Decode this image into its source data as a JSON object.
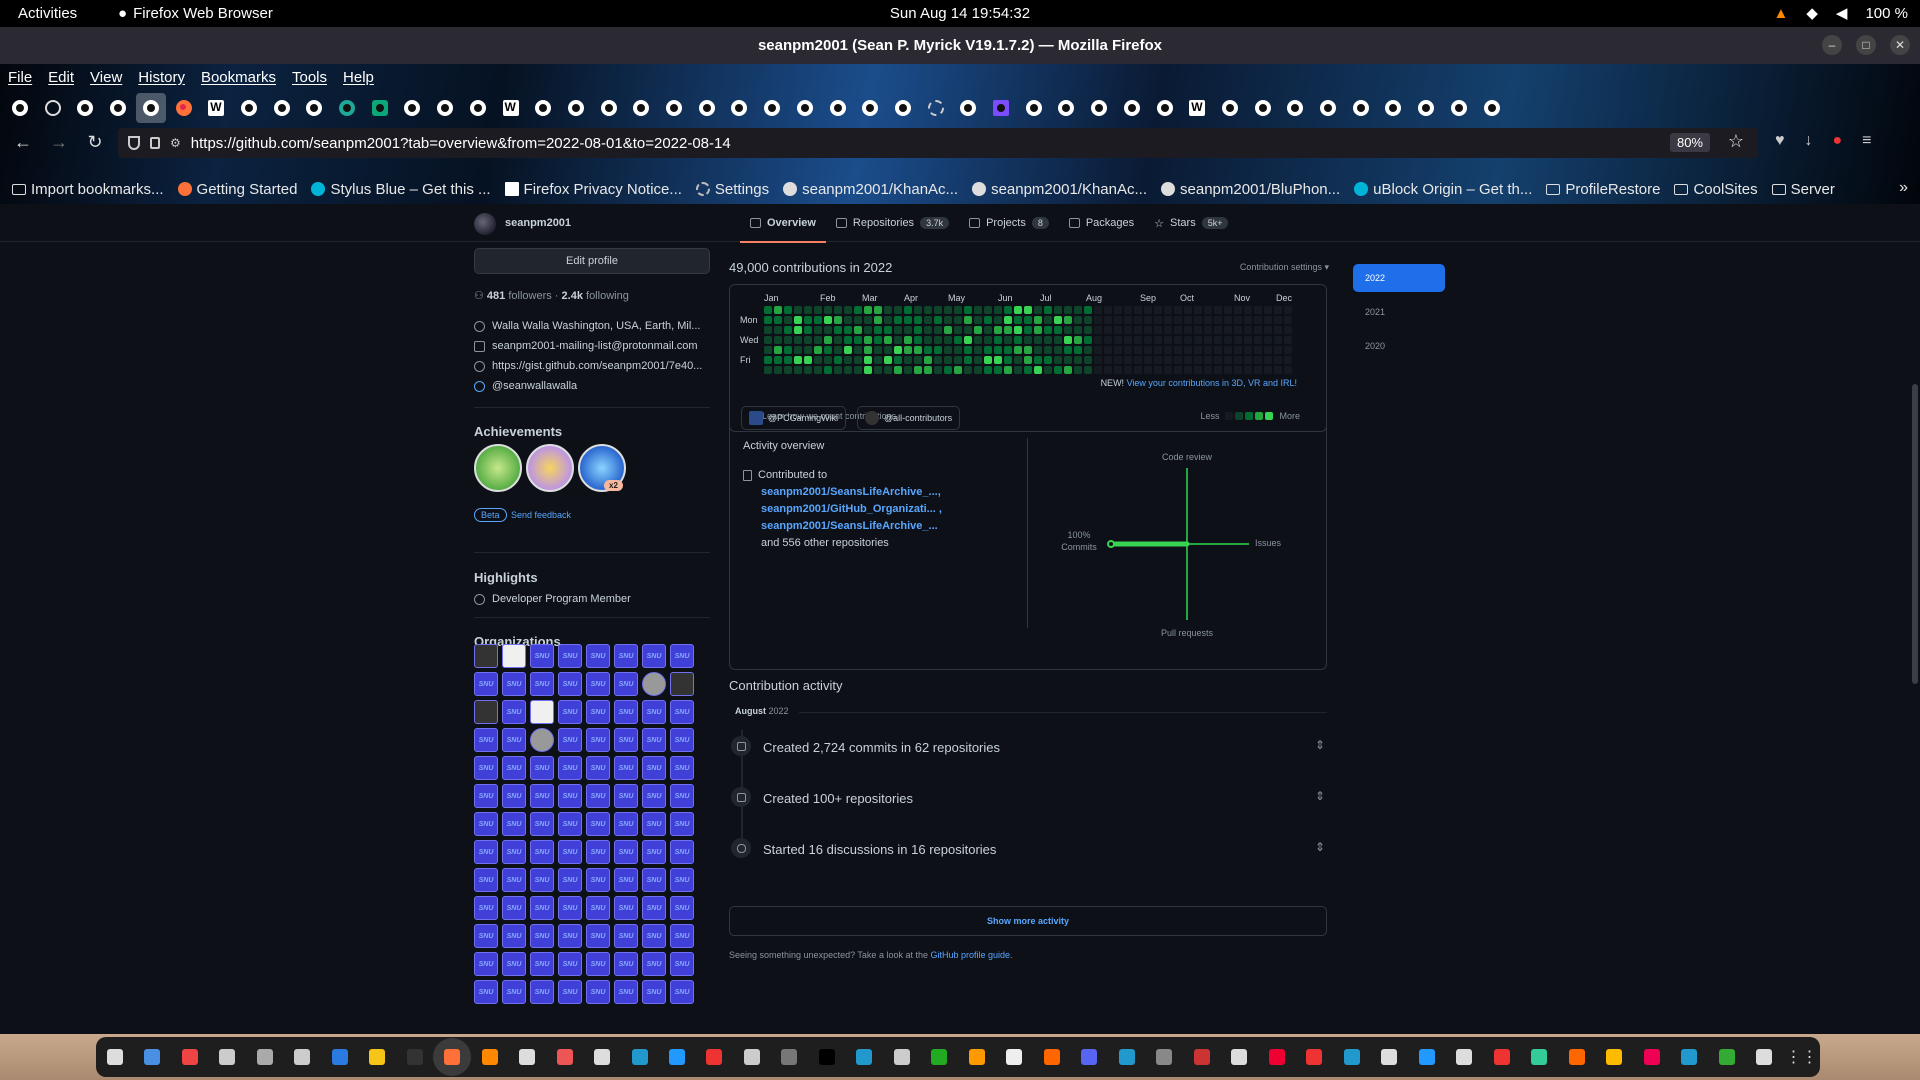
{
  "system": {
    "activities": "Activities",
    "app_name": "Firefox Web Browser",
    "clock": "Sun Aug 14  19:54:32",
    "battery": "100 %"
  },
  "window": {
    "title": "seanpm2001 (Sean P. Myrick V19.1.7.2) — Mozilla Firefox"
  },
  "menu": [
    "File",
    "Edit",
    "View",
    "History",
    "Bookmarks",
    "Tools",
    "Help"
  ],
  "tabs": {
    "icons": [
      "github",
      "globe",
      "github",
      "github",
      "github",
      "firefox",
      "wiki",
      "github",
      "github",
      "github",
      "teal",
      "green",
      "github",
      "github",
      "github",
      "wiki",
      "github",
      "github",
      "github",
      "github",
      "github",
      "github",
      "github",
      "github",
      "github",
      "github",
      "github",
      "github",
      "gear",
      "github",
      "purple",
      "github",
      "github",
      "github",
      "github",
      "github",
      "wiki",
      "github",
      "github",
      "github",
      "github",
      "github",
      "github",
      "github",
      "github",
      "github"
    ],
    "selected_index": 4
  },
  "address": {
    "url": "https://github.com/seanpm2001?tab=overview&from=2022-08-01&to=2022-08-14",
    "zoom": "80%"
  },
  "bookmarks": [
    {
      "label": "Import bookmarks...",
      "icon": "import-icon"
    },
    {
      "label": "Getting Started",
      "icon": "firefox-icon"
    },
    {
      "label": "Stylus Blue – Get this ...",
      "icon": "stylus-icon"
    },
    {
      "label": "Firefox Privacy Notice...",
      "icon": "mozilla-icon"
    },
    {
      "label": "Settings",
      "icon": "gear-icon"
    },
    {
      "label": "seanpm2001/KhanAc...",
      "icon": "github-icon"
    },
    {
      "label": "seanpm2001/KhanAc...",
      "icon": "github-icon"
    },
    {
      "label": "seanpm2001/BluPhon...",
      "icon": "github-icon"
    },
    {
      "label": "uBlock Origin – Get th...",
      "icon": "ublock-icon"
    },
    {
      "label": "ProfileRestore",
      "icon": "folder-icon"
    },
    {
      "label": "CoolSites",
      "icon": "folder-icon"
    },
    {
      "label": "Server",
      "icon": "folder-icon"
    }
  ],
  "profile": {
    "username": "seanpm2001",
    "edit_profile": "Edit profile",
    "followers_count": "481",
    "followers_label": " followers · ",
    "following_count": "2.4k",
    "following_label": " following",
    "location": "Walla Walla Washington, USA, Earth, Mil...",
    "email": "seanpm2001-mailing-list@protonmail.com",
    "website": "https://gist.github.com/seanpm2001/7e40...",
    "twitter": "@seanwallawalla",
    "achievements_title": "Achievements",
    "achievement_multiplier": "x2",
    "beta": "Beta",
    "send_feedback": "Send feedback",
    "highlights_title": "Highlights",
    "highlight_item": "Developer Program Member",
    "organizations_title": "Organizations",
    "org_tile_text": "SNU"
  },
  "nav_tabs": [
    {
      "label": "Overview",
      "count": ""
    },
    {
      "label": "Repositories",
      "count": "3.7k"
    },
    {
      "label": "Projects",
      "count": "8"
    },
    {
      "label": "Packages",
      "count": ""
    },
    {
      "label": "Stars",
      "count": "5k+"
    }
  ],
  "contributions": {
    "title": "49,000 contributions in 2022",
    "settings": "Contribution settings ▾",
    "months": [
      "Jan",
      "Feb",
      "Mar",
      "Apr",
      "May",
      "Jun",
      "Jul",
      "Aug",
      "Sep",
      "Oct",
      "Nov",
      "Dec"
    ],
    "days": [
      "Mon",
      "Wed",
      "Fri"
    ],
    "learn": "Learn how we count contributions",
    "less": "Less",
    "more": "More",
    "new_label": "NEW!",
    "new_link": "View your contributions in 3D, VR and IRL!"
  },
  "activity": {
    "org1": "@PCGamingWiki",
    "org2": "@all-contributors",
    "overview_title": "Activity overview",
    "contributed_to": "Contributed to",
    "repo1": "seanpm2001/SeansLifeArchive_...,",
    "repo2": "seanpm2001/GitHub_Organizati... ,",
    "repo3": "seanpm2001/SeansLifeArchive_...",
    "others": "and 556 other repositories",
    "code_review": "Code review",
    "issues": "Issues",
    "pull_requests": "Pull requests",
    "commits_pct": "100%",
    "commits": "Commits"
  },
  "timeline": {
    "title": "Contribution activity",
    "month": "August",
    "year": "2022",
    "items": [
      "Created 2,724 commits in 62 repositories",
      "Created 100+ repositories",
      "Started 16 discussions in 16 repositories"
    ],
    "show_more": "Show more activity",
    "unexpected": "Seeing something unexpected? Take a look at the ",
    "guide_link": "GitHub profile guide",
    "guide_end": "."
  },
  "years": [
    "2022",
    "2021",
    "2020"
  ],
  "colors": {
    "accent": "#58a6ff",
    "selected_year": "#1f6feb",
    "contrib_levels": [
      "#161b22",
      "#0e4429",
      "#006d32",
      "#26a641",
      "#39d353"
    ]
  }
}
